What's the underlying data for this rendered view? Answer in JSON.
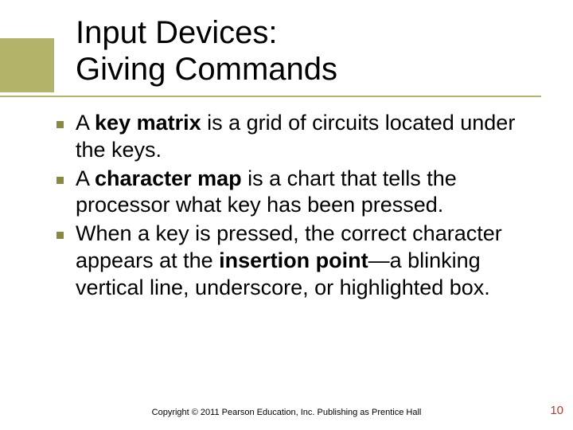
{
  "title": {
    "line1": "Input Devices:",
    "line2": "Giving Commands"
  },
  "bullets": [
    {
      "runs": [
        {
          "t": "A "
        },
        {
          "t": "key matrix",
          "b": true
        },
        {
          "t": " is a grid of circuits located under the keys."
        }
      ]
    },
    {
      "runs": [
        {
          "t": "A "
        },
        {
          "t": "character map",
          "b": true
        },
        {
          "t": " is a chart that tells the processor what key has been pressed."
        }
      ]
    },
    {
      "runs": [
        {
          "t": "When a key is pressed, the correct character appears at the "
        },
        {
          "t": "insertion point",
          "b": true
        },
        {
          "t": "—a blinking vertical line, underscore, or highlighted box."
        }
      ]
    }
  ],
  "footer": {
    "copyright": "Copyright © 2011 Pearson Education, Inc. Publishing as Prentice Hall",
    "page": "10"
  }
}
